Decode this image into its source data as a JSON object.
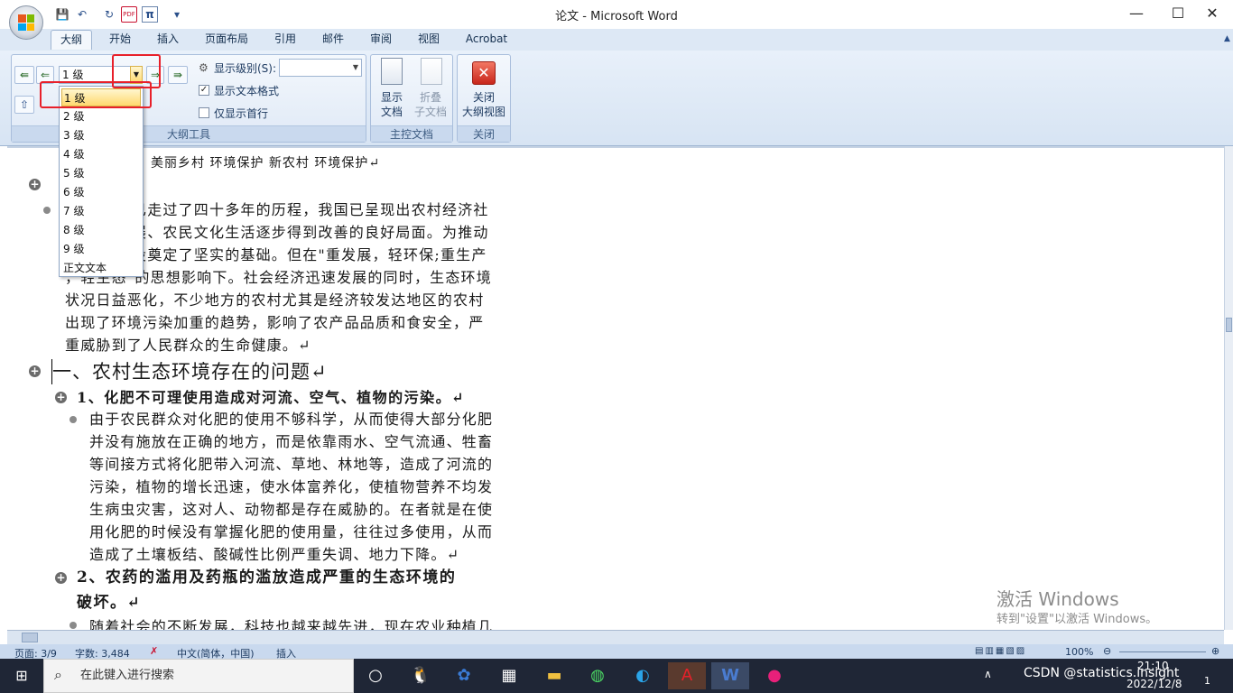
{
  "window": {
    "title": "论文 - Microsoft Word",
    "minimize": "—",
    "maximize": "☐",
    "close": "✕"
  },
  "quick_access": {
    "save": "💾",
    "undo": "↶",
    "redo": "↻",
    "pdf": "PDF",
    "pi": "π",
    "more": "▾"
  },
  "tabs": [
    {
      "label": "大纲",
      "active": true
    },
    {
      "label": "开始"
    },
    {
      "label": "插入"
    },
    {
      "label": "页面布局"
    },
    {
      "label": "引用"
    },
    {
      "label": "邮件"
    },
    {
      "label": "审阅"
    },
    {
      "label": "视图"
    },
    {
      "label": "Acrobat"
    }
  ],
  "ribbon": {
    "outline_tools": {
      "label": "大纲工具",
      "level_value": "1 级",
      "show_level_label": "显示级别(S):",
      "show_text_format_label": "显示文本格式",
      "show_text_format_checked": true,
      "show_first_line_label": "仅显示首行",
      "show_first_line_checked": false
    },
    "master_document": {
      "label": "主控文档",
      "show_document": [
        "显示",
        "文档"
      ],
      "collapse_subdocs": [
        "折叠",
        "子文档"
      ]
    },
    "close": {
      "label": "关闭",
      "close_outline": [
        "关闭",
        "大纲视图"
      ]
    }
  },
  "level_dropdown": {
    "options": [
      "1 级",
      "2 级",
      "3 级",
      "4 级",
      "5 级",
      "6 级",
      "7 级",
      "8 级",
      "9 级",
      "正文文本"
    ],
    "selected": "1 级"
  },
  "document": {
    "keywords_line": "美丽乡村   环境保护   新农村   环境保护↵",
    "intro_lines": [
      "已走过了四十多年的历程，我国已呈现出农村经济社",
      "展、农民文化生活逐步得到改善的良好局面。为推动",
      "设奠定了坚实的基础。但在\"重发展，轻环保;重生产",
      "，轻生态\"的思想影响下。社会经济迅速发展的同时，生态环境",
      "状况日益恶化，不少地方的农村尤其是经济较发达地区的农村",
      "出现了环境污染加重的趋势，影响了农产品品质和食安全，严",
      "重威胁到了人民群众的生命健康。↵"
    ],
    "heading1": "一、农村生态环境存在的问题↵",
    "heading2_1": "1、化肥不可理使用造成对河流、空气、植物的污染。↵",
    "para1_lines": [
      "由于农民群众对化肥的使用不够科学，从而使得大部分化肥",
      "并没有施放在正确的地方，而是依靠雨水、空气流通、牲畜",
      "等间接方式将化肥带入河流、草地、林地等，造成了河流的",
      "污染，植物的增长迅速，使水体富养化，使植物营养不均发",
      "生病虫灾害，这对人、动物都是存在威胁的。在者就是在使",
      "用化肥的时候没有掌握化肥的使用量，往往过多使用，从而",
      "造成了土壤板结、酸碱性比例严重失调、地力下降。↵"
    ],
    "heading2_2_line1": "2、农药的滥用及药瓶的滥放造成严重的生态环境的",
    "heading2_2_line2": "破坏。↵",
    "para2_partial": "随着社会的不断发展，科技也越来越先进，现在农业种植几"
  },
  "status_bar": {
    "page": "页面: 3/9",
    "words": "字数: 3,484",
    "language": "中文(简体，中国)",
    "mode": "插入",
    "zoom": "100%"
  },
  "watermark": {
    "line1": "激活 Windows",
    "line2": "转到\"设置\"以激活 Windows。"
  },
  "taskbar": {
    "search_placeholder": "在此键入进行搜索",
    "time": "21:10",
    "date": "2022/12/8",
    "csdn": "CSDN @statistics.insight",
    "notif_count": "1"
  }
}
